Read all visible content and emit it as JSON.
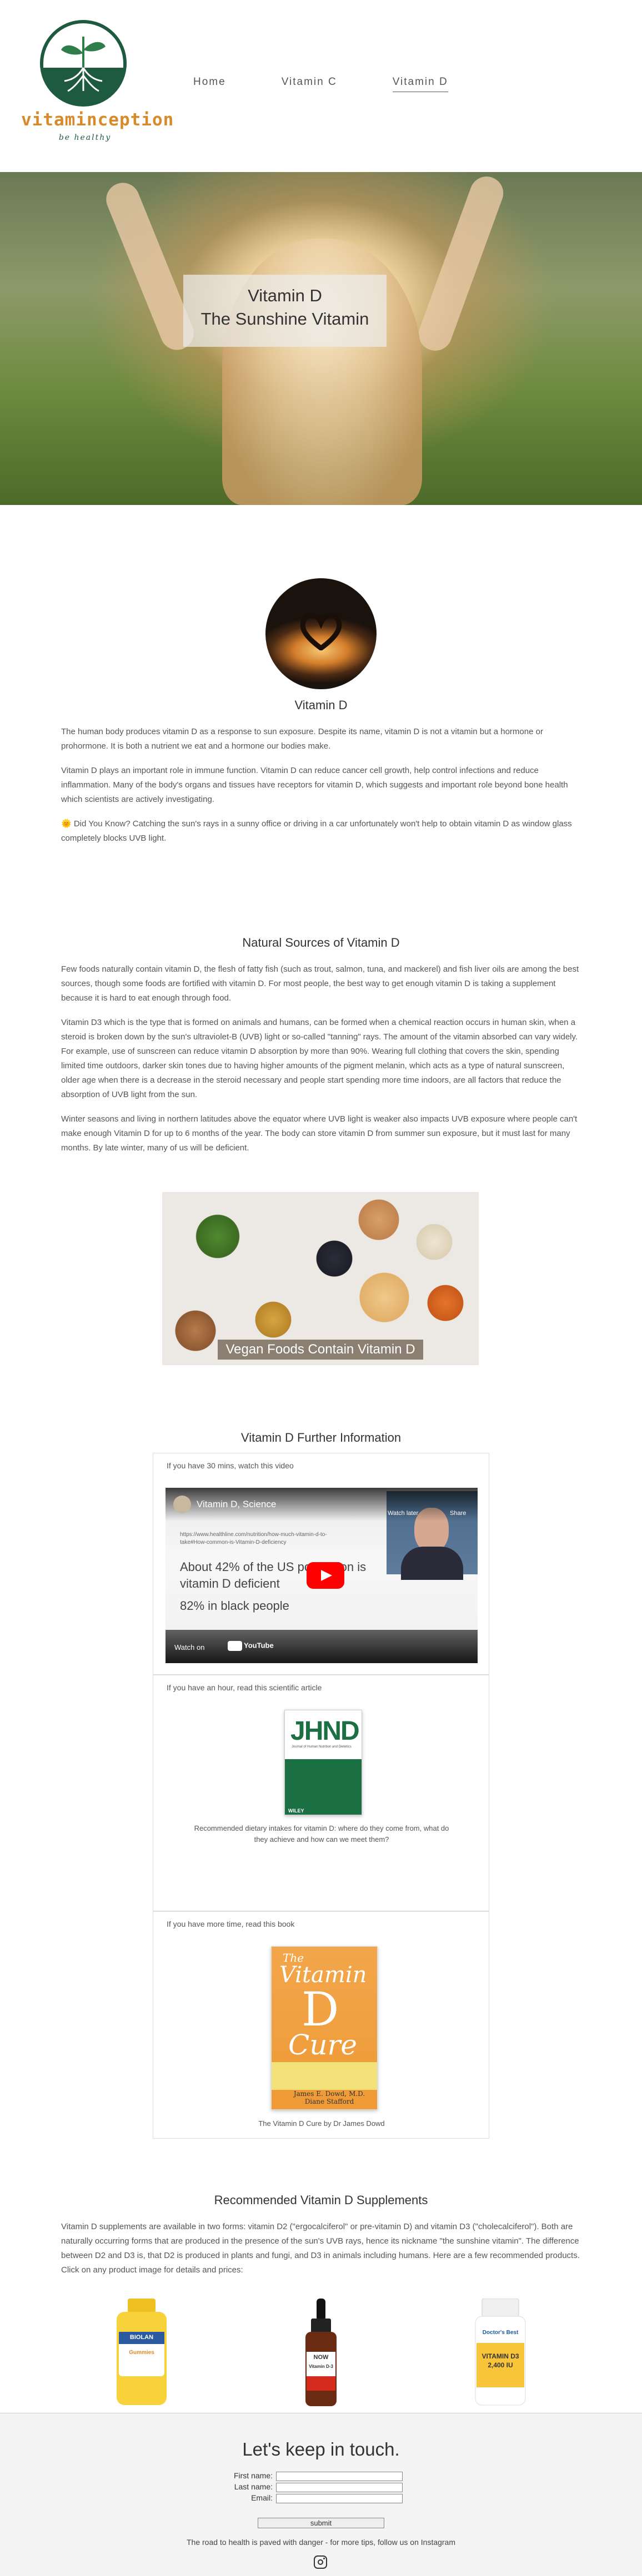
{
  "brand": {
    "name": "vitaminception",
    "tagline": "be healthy",
    "colors": {
      "green": "#1e5a3f",
      "orange": "#d88a2a"
    }
  },
  "nav": [
    {
      "label": "Home",
      "active": false
    },
    {
      "label": "Vitamin C",
      "active": false
    },
    {
      "label": "Vitamin D",
      "active": true
    }
  ],
  "hero": {
    "line1": "Vitamin D",
    "line2": "The Sunshine Vitamin"
  },
  "intro": {
    "title": "Vitamin D",
    "paragraphs": [
      "The human body produces vitamin D as a response to sun exposure. Despite its name, vitamin D is not a vitamin but a hormone or prohormone. It is both a nutrient we eat and a hormone our bodies make.",
      "Vitamin D plays an important role in immune function. Vitamin D can reduce cancer cell growth, help control infections and reduce inflammation. Many of the body's organs and tissues have receptors for vitamin D, which suggests and important role beyond bone health which scientists are actively investigating.",
      "🌞 Did You Know? Catching the sun's rays in a sunny office or driving in a car unfortunately won't help to obtain vitamin D as window glass completely blocks UVB light."
    ]
  },
  "sources": {
    "title": "Natural Sources of Vitamin D",
    "paragraphs": [
      "Few foods naturally contain vitamin D, the flesh of fatty fish (such as trout, salmon, tuna, and mackerel) and fish liver oils are among the best sources, though some foods are fortified with vitamin D. For most people, the best way to get enough vitamin D is taking a supplement because it is hard to eat enough through food.",
      "Vitamin D3 which is the type that is formed on animals and humans, can be formed when a chemical reaction occurs in human skin, when a steroid is broken down by the sun's ultraviolet-B (UVB) light or so-called \"tanning\" rays. The amount of the vitamin absorbed can vary widely. For example, use of sunscreen can reduce vitamin D absorption by more than 90%. Wearing full clothing that covers the skin, spending limited time outdoors, darker skin tones due to having higher amounts of the pigment melanin, which acts as a type of natural sunscreen, older age when there is a decrease in the steroid necessary and people start spending more time indoors, are all factors that reduce the absorption of UVB light from the sun.",
      "Winter seasons and living in northern latitudes above the equator where UVB light is weaker also impacts UVB exposure where people can't make enough Vitamin D for up to 6 months of the year. The body can store vitamin D from summer sun exposure, but it must last for many months. By late winter, many of us will be deficient."
    ],
    "image_caption": "Vegan Foods Contain Vitamin D"
  },
  "further": {
    "title": "Vitamin D Further Information",
    "video": {
      "label": "If you have 30 mins, watch this video",
      "channel_title": "Vitamin D, Science",
      "url_text": "https://www.healthline.com/nutrition/how-much-vitamin-d-to-take#How-common-is-Vitamin-D-deficiency",
      "stat1": "About 42% of the US population is vitamin D deficient",
      "stat2": "82% in black people",
      "watch_later": "Watch later",
      "share": "Share",
      "watch_on": "Watch on",
      "youtube": "YouTube"
    },
    "article": {
      "label": "If you have an hour, read this scientific article",
      "journal": "JHND",
      "journal_sub": "Journal of Human Nutrition and Dietetics",
      "publisher": "WILEY",
      "caption": "Recommended dietary intakes for vitamin D: where do they come from, what do they achieve and how can we meet them?"
    },
    "book": {
      "label": "If you have more time, read this book",
      "the": "The",
      "vitamin": "Vitamin",
      "d": "D",
      "cure": "Cure",
      "authors": "James E. Dowd, M.D. Diane Stafford",
      "caption": "The Vitamin D Cure by Dr James Dowd"
    }
  },
  "supplements": {
    "title": "Recommended Vitamin D Supplements",
    "paragraph": "Vitamin D supplements are available in two forms: vitamin D2 (\"ergocalciferol\" or pre-vitamin D) and vitamin D3 (\"cholecalciferol\"). Both are naturally occurring forms that are produced in the presence of the sun's UVB rays, hence its nickname \"the sunshine vitamin\". The difference between D2 and D3 is, that D2 is produced in plants and fungi, and D3 in animals including humans. Here are a few recommended products. Click on any product image for details and prices:",
    "products": [
      {
        "brand": "BIOLAN",
        "name": "Gummies"
      },
      {
        "brand": "NOW",
        "name": "Vitamin D-3"
      },
      {
        "brand": "Doctor's Best",
        "name": "VITAMIN D3 2,400 IU"
      }
    ]
  },
  "footer": {
    "title": "Let's keep in touch.",
    "first_name": "First name:",
    "last_name": "Last name:",
    "email": "Email:",
    "submit": "submit",
    "note": "The road to health is paved with danger - for more tips, follow us on Instagram"
  }
}
